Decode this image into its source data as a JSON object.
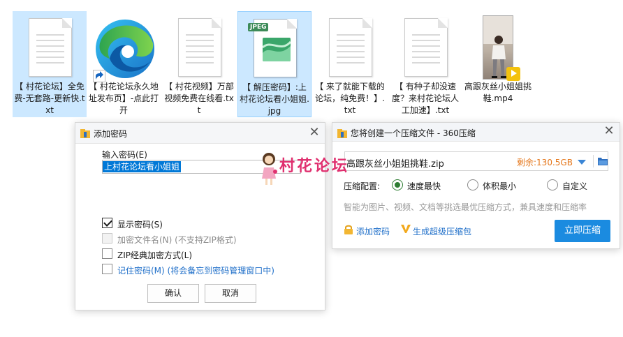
{
  "files": [
    {
      "name": "【 村花论坛】全免费-无套路-更新快.txt",
      "kind": "txt"
    },
    {
      "name": "【 村花论坛永久地址发布页】-点此打开",
      "kind": "shortcut"
    },
    {
      "name": "【 村花视频】万部视频免费在线看.txt",
      "kind": "txt"
    },
    {
      "name": "【 解压密码】:上村花论坛看小姐姐.jpg",
      "kind": "jpg",
      "badge": "JPEG"
    },
    {
      "name": "【 来了就能下载的论坛，纯免费！】.txt",
      "kind": "txt"
    },
    {
      "name": "【 有种子却没速度？来村花论坛人工加速】.txt",
      "kind": "txt"
    },
    {
      "name": "高跟灰丝小姐姐挑鞋.mp4",
      "kind": "mp4",
      "badge": "Player"
    }
  ],
  "password_dialog": {
    "title": "添加密码",
    "input_label": "输入密码(E)",
    "password_value": "上村花论坛看小姐姐",
    "options": [
      {
        "label": "显示密码(S)",
        "checked": true,
        "disabled": false
      },
      {
        "label": "加密文件名(N) (不支持ZIP格式)",
        "checked": false,
        "disabled": true
      },
      {
        "label": "ZIP经典加密方式(L)",
        "checked": false,
        "disabled": false
      },
      {
        "label": "记住密码(M) (将会备忘到密码管理窗口中)",
        "checked": false,
        "disabled": false
      }
    ],
    "ok_label": "确认",
    "cancel_label": "取消"
  },
  "compress_dialog": {
    "title": "您将创建一个压缩文件 - 360压缩",
    "filename": "高跟灰丝小姐姐挑鞋.zip",
    "free_space": "剩余:130.5GB",
    "config_label": "压缩配置:",
    "modes": [
      "速度最快",
      "体积最小",
      "自定义"
    ],
    "selected_mode": "速度最快",
    "hint": "智能为图片、视频、文档等挑选最优压缩方式，兼具速度和压缩率",
    "add_password": "添加密码",
    "super_package": "生成超级压缩包",
    "compress_now": "立即压缩"
  },
  "watermark": "村花论坛",
  "colors": {
    "accent": "#1b8be0",
    "selection": "#cce8ff",
    "link": "#1f6fc9",
    "free_space": "#e5781d",
    "watermark": "#e0306f"
  }
}
